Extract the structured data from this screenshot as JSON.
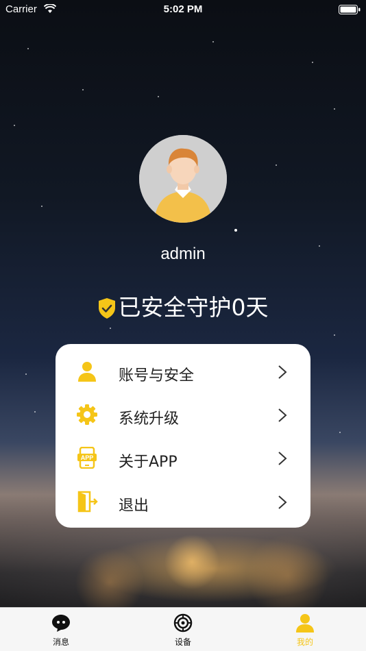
{
  "status_bar": {
    "carrier": "Carrier",
    "time": "5:02 PM"
  },
  "profile": {
    "username": "admin",
    "protect_text": "已安全守护0天"
  },
  "menu": {
    "items": [
      {
        "label": "账号与安全",
        "icon": "person-icon"
      },
      {
        "label": "系统升级",
        "icon": "gear-icon"
      },
      {
        "label": "关于APP",
        "icon": "app-phone-icon"
      },
      {
        "label": "退出",
        "icon": "logout-door-icon"
      }
    ]
  },
  "tab_bar": {
    "tabs": [
      {
        "label": "消息",
        "icon": "message-bubble-icon",
        "active": false
      },
      {
        "label": "设备",
        "icon": "device-lens-icon",
        "active": false
      },
      {
        "label": "我的",
        "icon": "person-icon",
        "active": true
      }
    ]
  },
  "colors": {
    "accent": "#f5c518",
    "card": "#ffffff",
    "tab_bar_bg": "#f6f6f6"
  }
}
